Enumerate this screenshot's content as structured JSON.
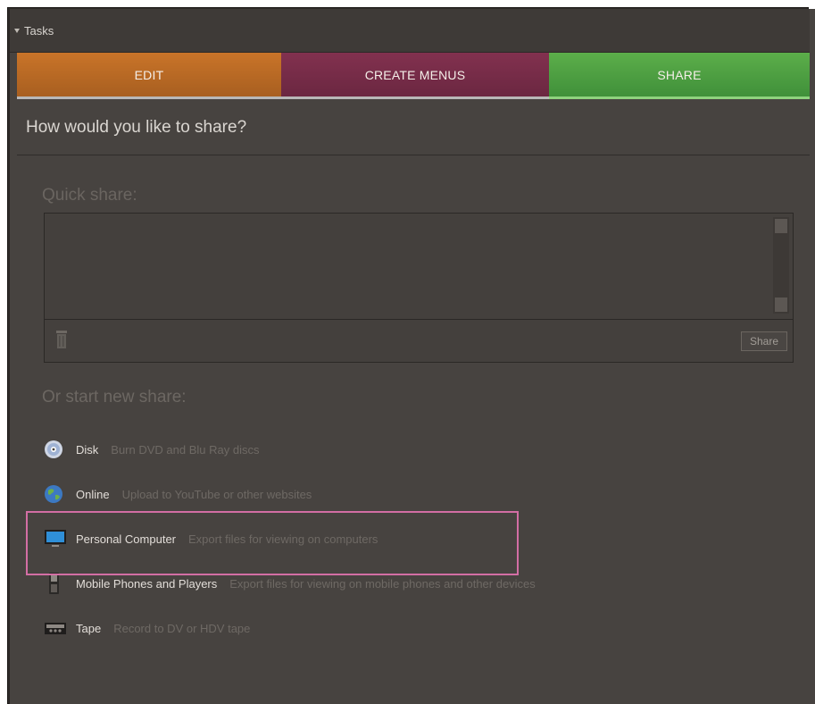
{
  "panel": {
    "title": "Tasks"
  },
  "tabs": [
    {
      "label": "EDIT",
      "color": "#b8692a"
    },
    {
      "label": "CREATE MENUS",
      "color": "#762d49"
    },
    {
      "label": "SHARE",
      "color": "#4ea043",
      "active": true
    }
  ],
  "question": "How would you like to share?",
  "quick_share": {
    "title": "Quick share:",
    "share_button": "Share",
    "icons": {
      "delete": "trash-icon"
    }
  },
  "new_share": {
    "title": "Or start new share:",
    "options": [
      {
        "name": "Disk",
        "description": "Burn DVD and Blu Ray discs",
        "icon": "disc-icon"
      },
      {
        "name": "Online",
        "description": "Upload to YouTube or other websites",
        "icon": "globe-icon"
      },
      {
        "name": "Personal Computer",
        "description": "Export files for viewing on computers",
        "icon": "monitor-icon",
        "highlighted": true
      },
      {
        "name": "Mobile Phones and Players",
        "description": "Export files for viewing on mobile phones and other devices",
        "icon": "mobile-phone-icon"
      },
      {
        "name": "Tape",
        "description": "Record to DV or HDV tape",
        "icon": "tape-icon"
      }
    ]
  },
  "colors": {
    "highlight": "#d36ea4",
    "background": "#474340"
  }
}
